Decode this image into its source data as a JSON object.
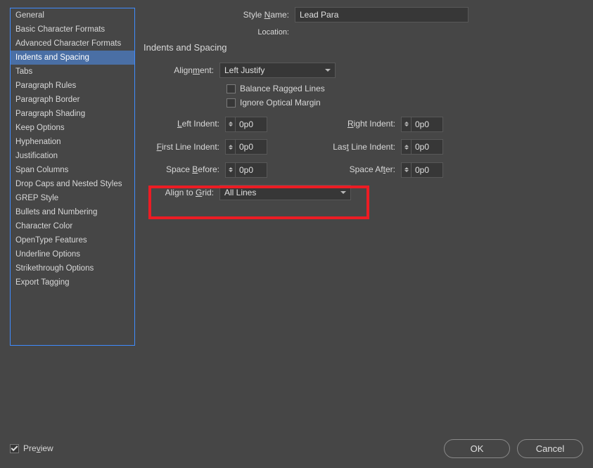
{
  "sidebar": {
    "items": [
      {
        "label": "General"
      },
      {
        "label": "Basic Character Formats"
      },
      {
        "label": "Advanced Character Formats"
      },
      {
        "label": "Indents and Spacing",
        "selected": true
      },
      {
        "label": "Tabs"
      },
      {
        "label": "Paragraph Rules"
      },
      {
        "label": "Paragraph Border"
      },
      {
        "label": "Paragraph Shading"
      },
      {
        "label": "Keep Options"
      },
      {
        "label": "Hyphenation"
      },
      {
        "label": "Justification"
      },
      {
        "label": "Span Columns"
      },
      {
        "label": "Drop Caps and Nested Styles"
      },
      {
        "label": "GREP Style"
      },
      {
        "label": "Bullets and Numbering"
      },
      {
        "label": "Character Color"
      },
      {
        "label": "OpenType Features"
      },
      {
        "label": "Underline Options"
      },
      {
        "label": "Strikethrough Options"
      },
      {
        "label": "Export Tagging"
      }
    ]
  },
  "header": {
    "style_name_label_pre": "Style ",
    "style_name_label_u": "N",
    "style_name_label_post": "ame:",
    "style_name_value": "Lead Para",
    "location_label": "Location:"
  },
  "panel": {
    "title": "Indents and Spacing",
    "alignment_label_pre": "Align",
    "alignment_label_u": "m",
    "alignment_label_post": "ent:",
    "alignment_value": "Left Justify",
    "balance_ragged_label": "Balance Ragged Lines",
    "ignore_optical_label": "Ignore Optical Margin",
    "left_indent_label_u": "L",
    "left_indent_label_post": "eft Indent:",
    "left_indent_value": "0p0",
    "right_indent_label_pre": "",
    "right_indent_label_u": "R",
    "right_indent_label_post": "ight Indent:",
    "right_indent_value": "0p0",
    "first_line_label_u": "F",
    "first_line_label_post": "irst Line Indent:",
    "first_line_value": "0p0",
    "last_line_label_pre": "Las",
    "last_line_label_u": "t",
    "last_line_label_post": " Line Indent:",
    "last_line_value": "0p0",
    "space_before_label_pre": "Space ",
    "space_before_label_u": "B",
    "space_before_label_post": "efore:",
    "space_before_value": "0p0",
    "space_after_label_pre": "Space Af",
    "space_after_label_u": "t",
    "space_after_label_post": "er:",
    "space_after_value": "0p0",
    "align_grid_label_pre": "Align to ",
    "align_grid_label_u": "G",
    "align_grid_label_post": "rid:",
    "align_grid_value": "All Lines"
  },
  "footer": {
    "preview_label_pre": "Pre",
    "preview_label_u": "v",
    "preview_label_post": "iew",
    "preview_checked": true,
    "ok_label": "OK",
    "cancel_label": "Cancel"
  }
}
